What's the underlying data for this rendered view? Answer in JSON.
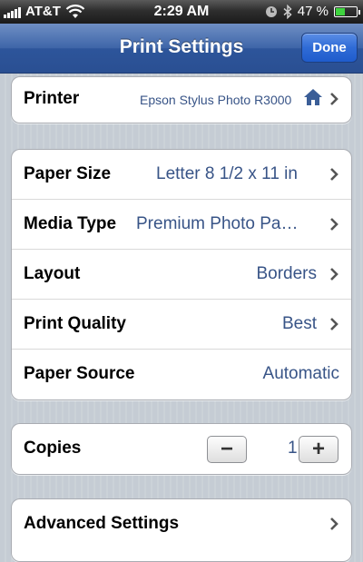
{
  "status_bar": {
    "carrier": "AT&T",
    "time": "2:29 AM",
    "battery": "47 %",
    "battery_level": 0.47
  },
  "nav": {
    "title": "Print Settings",
    "done_label": "Done"
  },
  "printer": {
    "label": "Printer",
    "value": "Epson Stylus Photo R3000"
  },
  "paper_settings": [
    {
      "label": "Paper Size",
      "value": "Letter 8 1/2 x 11 in"
    },
    {
      "label": "Media Type",
      "value": "Premium Photo Pa…"
    },
    {
      "label": "Layout",
      "value": "Borders"
    },
    {
      "label": "Print Quality",
      "value": "Best"
    },
    {
      "label": "Paper Source",
      "value": "Automatic"
    }
  ],
  "copies": {
    "label": "Copies",
    "value": "1",
    "minus": "−",
    "plus": "+"
  },
  "advanced": {
    "label": "Advanced Settings"
  },
  "colors": {
    "nav_blue": "#3e65a8",
    "value_blue": "#385487",
    "done_blue": "#2f6bd6"
  },
  "icons": [
    "signal-icon",
    "wifi-icon",
    "clock-icon",
    "bluetooth-icon",
    "battery-icon",
    "home-icon",
    "chevron-right-icon"
  ]
}
